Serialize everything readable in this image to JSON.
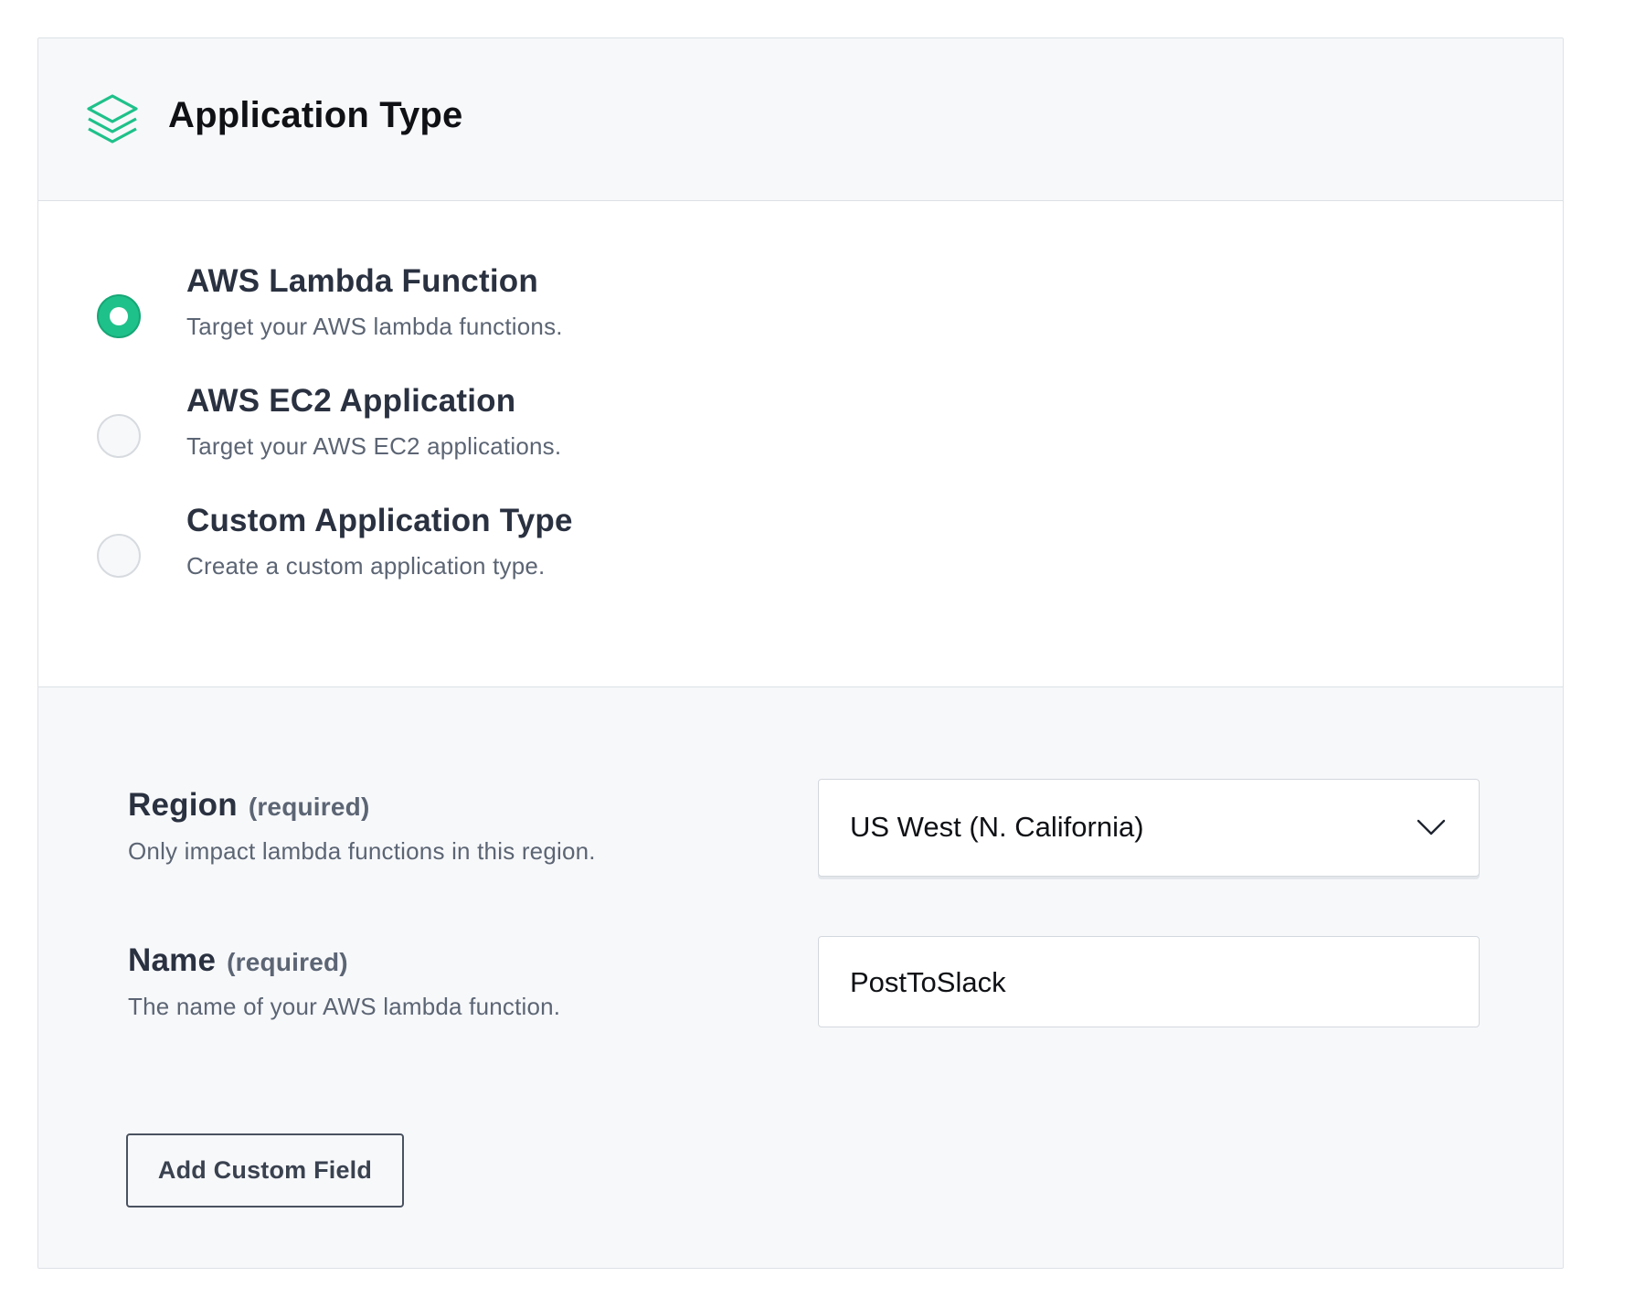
{
  "header": {
    "title": "Application Type",
    "icon": "layers-icon",
    "icon_color": "#1fc18a"
  },
  "options": [
    {
      "title": "AWS Lambda Function",
      "description": "Target your AWS lambda functions.",
      "checked": true
    },
    {
      "title": "AWS EC2 Application",
      "description": "Target your AWS EC2 applications.",
      "checked": false
    },
    {
      "title": "Custom Application Type",
      "description": "Create a custom application type.",
      "checked": false
    }
  ],
  "fields": {
    "region": {
      "label": "Region",
      "required": "(required)",
      "description": "Only impact lambda functions in this region.",
      "value": "US West (N. California)"
    },
    "name": {
      "label": "Name",
      "required": "(required)",
      "description": "The name of your AWS lambda function.",
      "value": "PostToSlack"
    }
  },
  "actions": {
    "add_custom_field": "Add Custom Field"
  },
  "colors": {
    "accent": "#1fc18a",
    "text": "#2a3140",
    "muted": "#5c6574"
  }
}
